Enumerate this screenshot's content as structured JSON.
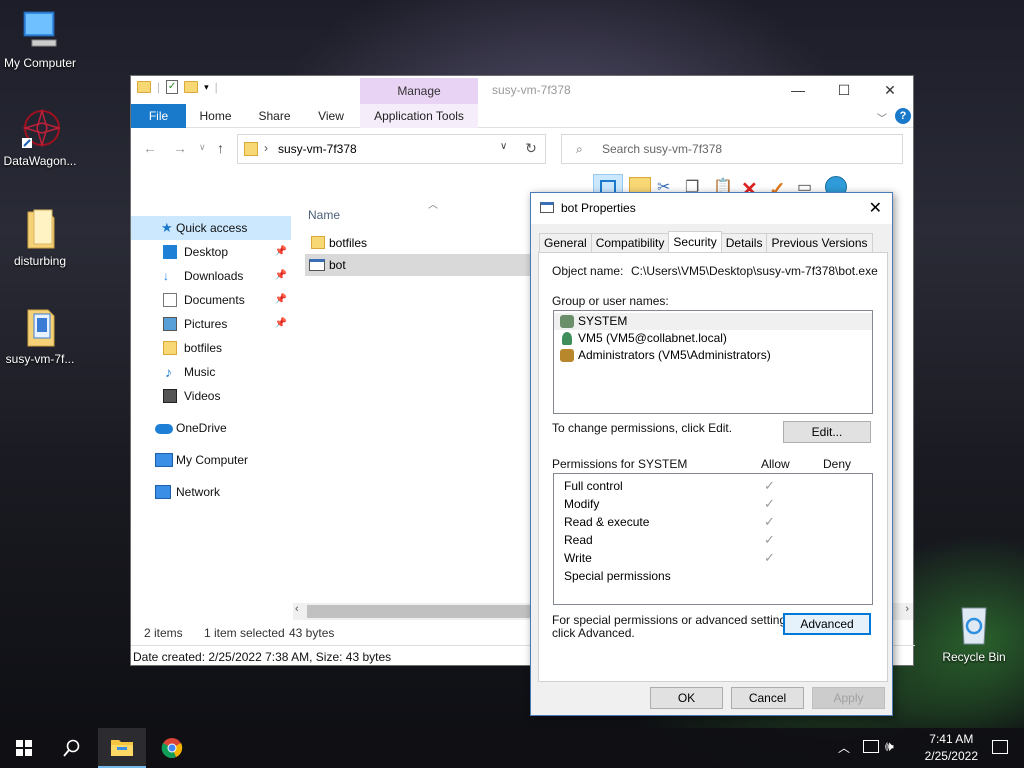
{
  "desktop": {
    "icons": [
      {
        "label": "My Computer"
      },
      {
        "label": "DataWagon..."
      },
      {
        "label": "disturbing"
      },
      {
        "label": "susy-vm-7f..."
      },
      {
        "label": "Recycle Bin"
      }
    ]
  },
  "explorer": {
    "title": "susy-vm-7f378",
    "context_tab": "Manage",
    "ribbon_tabs": [
      "File",
      "Home",
      "Share",
      "View",
      "Application Tools"
    ],
    "address": "susy-vm-7f378",
    "search_placeholder": "Search susy-vm-7f378",
    "nav": [
      {
        "label": "Quick access",
        "pinned": false
      },
      {
        "label": "Desktop",
        "pinned": true
      },
      {
        "label": "Downloads",
        "pinned": true
      },
      {
        "label": "Documents",
        "pinned": true
      },
      {
        "label": "Pictures",
        "pinned": true
      },
      {
        "label": "botfiles",
        "pinned": false
      },
      {
        "label": "Music",
        "pinned": false
      },
      {
        "label": "Videos",
        "pinned": false
      },
      {
        "label": "OneDrive",
        "pinned": false
      },
      {
        "label": "My Computer",
        "pinned": false
      },
      {
        "label": "Network",
        "pinned": false
      }
    ],
    "column_name": "Name",
    "files": [
      {
        "name": "botfiles",
        "type": "folder"
      },
      {
        "name": "bot",
        "type": "exe"
      }
    ],
    "status": {
      "items": "2 items",
      "selected": "1 item selected",
      "size": "43 bytes"
    },
    "info": "Date created: 2/25/2022 7:38 AM, Size: 43 bytes"
  },
  "dialog": {
    "title": "bot Properties",
    "tabs": [
      "General",
      "Compatibility",
      "Security",
      "Details",
      "Previous Versions"
    ],
    "active_tab": "Security",
    "object_name_label": "Object name:",
    "object_name": "C:\\Users\\VM5\\Desktop\\susy-vm-7f378\\bot.exe",
    "group_label": "Group or user names:",
    "groups": [
      "SYSTEM",
      "VM5 (VM5@collabnet.local)",
      "Administrators (VM5\\Administrators)"
    ],
    "change_text": "To change permissions, click Edit.",
    "edit_button": "Edit...",
    "perm_label": "Permissions for SYSTEM",
    "allow": "Allow",
    "deny": "Deny",
    "permissions": [
      {
        "name": "Full control",
        "allow": true
      },
      {
        "name": "Modify",
        "allow": true
      },
      {
        "name": "Read & execute",
        "allow": true
      },
      {
        "name": "Read",
        "allow": true
      },
      {
        "name": "Write",
        "allow": true
      },
      {
        "name": "Special permissions",
        "allow": false
      }
    ],
    "advanced_text_1": "For special permissions or advanced settings,",
    "advanced_text_2": "click Advanced.",
    "advanced_button": "Advanced",
    "ok": "OK",
    "cancel": "Cancel",
    "apply": "Apply",
    "check_glyph": "✓"
  },
  "taskbar": {
    "time": "7:41 AM",
    "date": "2/25/2022"
  }
}
